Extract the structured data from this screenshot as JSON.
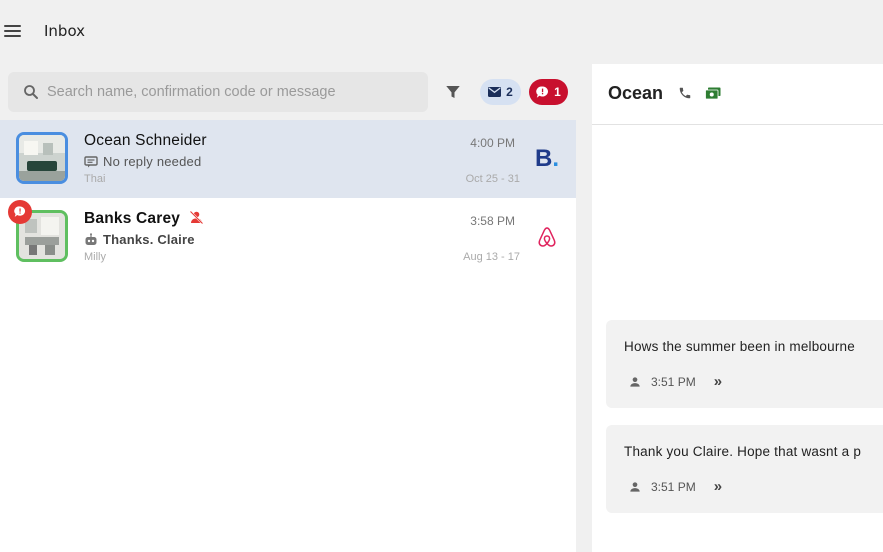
{
  "header": {
    "title": "Inbox"
  },
  "search": {
    "placeholder": "Search name, confirmation code or message"
  },
  "badges": {
    "unread_mail": "2",
    "alerts": "1"
  },
  "colors": {
    "booking_brand": "#1f3b8a",
    "airbnb_brand": "#e0245e",
    "alert_red": "#c8102e",
    "selected_row": "#dfe5ef"
  },
  "conversations": [
    {
      "name": "Ocean Schneider",
      "subtext": "No reply needed",
      "room": "Thai",
      "time": "4:00 PM",
      "dates": "Oct 25 - 31",
      "channel": "booking",
      "channel_letter": "B",
      "channel_dot": ".",
      "selected": true
    },
    {
      "name": "Banks Carey",
      "subtext": "Thanks. Claire",
      "room": "Milly",
      "time": "3:58 PM",
      "dates": "Aug 13 - 17",
      "channel": "airbnb",
      "selected": false
    }
  ],
  "detail": {
    "name": "Ocean",
    "messages": [
      {
        "text": "Hows the summer been in melbourne",
        "time": "3:51 PM"
      },
      {
        "text": "Thank you Claire. Hope that wasnt a p",
        "time": "3:51 PM"
      }
    ]
  }
}
